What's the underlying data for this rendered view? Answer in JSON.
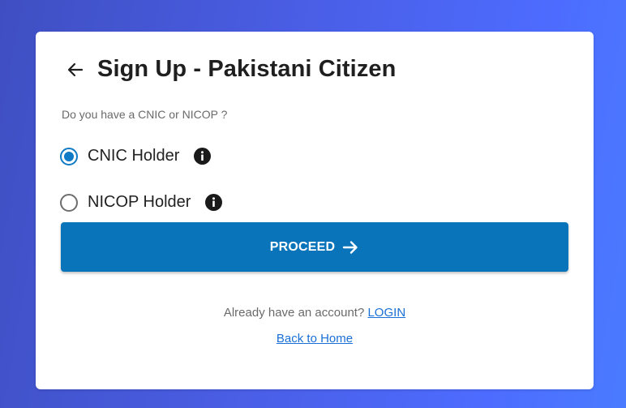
{
  "header": {
    "title": "Sign Up - Pakistani Citizen"
  },
  "form": {
    "question": "Do you have a CNIC or NICOP ?",
    "options": [
      {
        "label": "CNIC Holder",
        "selected": true
      },
      {
        "label": "NICOP Holder",
        "selected": false
      }
    ],
    "proceed_label": "PROCEED"
  },
  "footer": {
    "account_prompt": "Already have an account?",
    "login_link": "LOGIN",
    "home_link": "Back to Home"
  },
  "icons": {
    "back": "arrow-left-icon",
    "info": "info-icon",
    "proceed": "arrow-right-icon"
  },
  "colors": {
    "primary": "#0a74bb",
    "radio_checked": "#0f7ac5",
    "link": "#1a6fd6"
  }
}
